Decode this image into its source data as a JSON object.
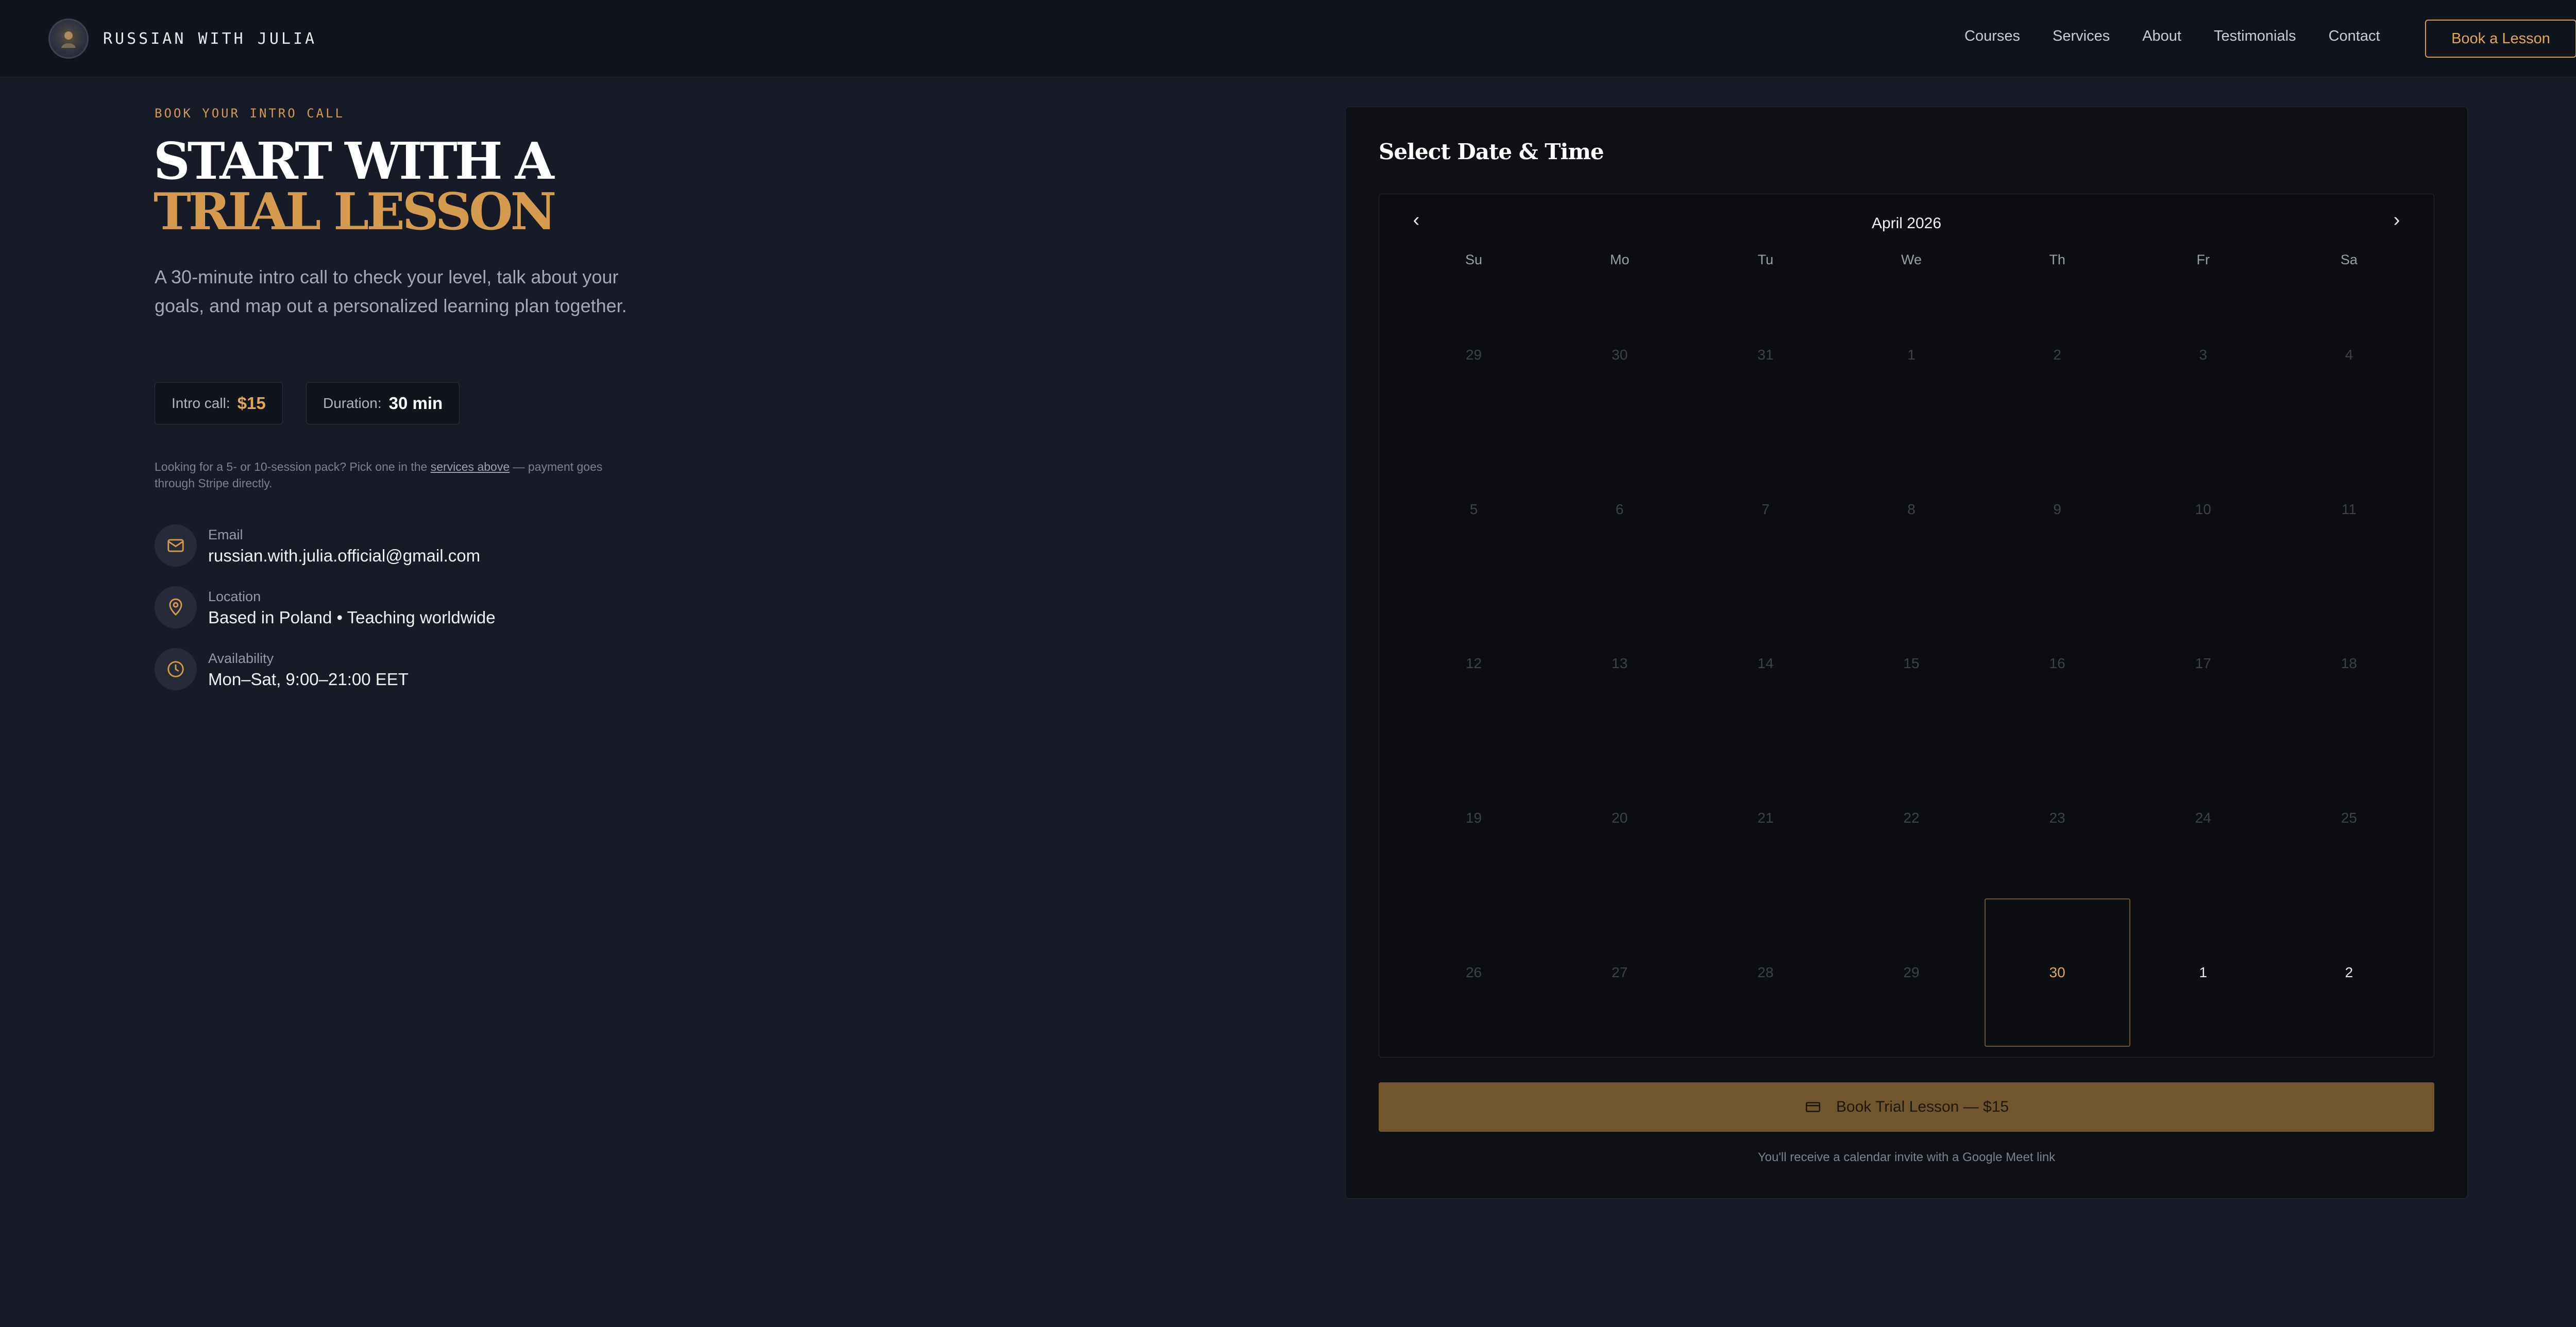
{
  "brand": {
    "name": "RUSSIAN WITH JULIA"
  },
  "nav": {
    "links": [
      "Courses",
      "Services",
      "About",
      "Testimonials",
      "Contact"
    ],
    "cta": "Book a Lesson"
  },
  "hero": {
    "eyebrow": "BOOK YOUR INTRO CALL",
    "title_line1": "START WITH A",
    "title_line2": "TRIAL LESSON",
    "lead": "A 30-minute intro call to check your level, talk about your goals, and map out a personalized learning plan together."
  },
  "pills": {
    "price_label": "Intro call:",
    "price_value": "$15",
    "duration_label": "Duration:",
    "duration_value": "30 min"
  },
  "note": {
    "before": "Looking for a 5- or 10-session pack? Pick one in the ",
    "link": "services above",
    "after": " — payment goes through Stripe directly."
  },
  "contact": {
    "email_label": "Email",
    "email_value": "russian.with.julia.official@gmail.com",
    "location_label": "Location",
    "location_value": "Based in Poland • Teaching worldwide",
    "availability_label": "Availability",
    "availability_value": "Mon–Sat, 9:00–21:00 EET"
  },
  "booking": {
    "title": "Select Date & Time",
    "month": "April 2026",
    "weekdays": [
      "Su",
      "Mo",
      "Tu",
      "We",
      "Th",
      "Fr",
      "Sa"
    ],
    "days": [
      {
        "label": "29",
        "state": "muted"
      },
      {
        "label": "30",
        "state": "muted"
      },
      {
        "label": "31",
        "state": "muted"
      },
      {
        "label": "1",
        "state": "muted"
      },
      {
        "label": "2",
        "state": "muted"
      },
      {
        "label": "3",
        "state": "muted"
      },
      {
        "label": "4",
        "state": "muted"
      },
      {
        "label": "5",
        "state": "muted"
      },
      {
        "label": "6",
        "state": "muted"
      },
      {
        "label": "7",
        "state": "muted"
      },
      {
        "label": "8",
        "state": "muted"
      },
      {
        "label": "9",
        "state": "muted"
      },
      {
        "label": "10",
        "state": "muted"
      },
      {
        "label": "11",
        "state": "muted"
      },
      {
        "label": "12",
        "state": "muted"
      },
      {
        "label": "13",
        "state": "muted"
      },
      {
        "label": "14",
        "state": "muted"
      },
      {
        "label": "15",
        "state": "muted"
      },
      {
        "label": "16",
        "state": "muted"
      },
      {
        "label": "17",
        "state": "muted"
      },
      {
        "label": "18",
        "state": "muted"
      },
      {
        "label": "19",
        "state": "muted"
      },
      {
        "label": "20",
        "state": "muted"
      },
      {
        "label": "21",
        "state": "muted"
      },
      {
        "label": "22",
        "state": "muted"
      },
      {
        "label": "23",
        "state": "muted"
      },
      {
        "label": "24",
        "state": "muted"
      },
      {
        "label": "25",
        "state": "muted"
      },
      {
        "label": "26",
        "state": "muted"
      },
      {
        "label": "27",
        "state": "muted"
      },
      {
        "label": "28",
        "state": "muted"
      },
      {
        "label": "29",
        "state": "muted"
      },
      {
        "label": "30",
        "state": "today"
      },
      {
        "label": "1",
        "state": "active"
      },
      {
        "label": "2",
        "state": "active"
      }
    ],
    "button_label": "Book Trial Lesson — $15",
    "footnote": "You'll receive a calendar invite with a Google Meet link"
  },
  "colors": {
    "background": "#171b27",
    "nav_background": "#10141d",
    "accent": "#d49a4d",
    "card_background": "#0e1015",
    "button_background": "#70552e"
  },
  "icons": {
    "prev": "chevron-left-icon",
    "next": "chevron-right-icon",
    "email": "mail-icon",
    "location": "map-pin-icon",
    "availability": "clock-icon",
    "button": "credit-card-icon"
  }
}
